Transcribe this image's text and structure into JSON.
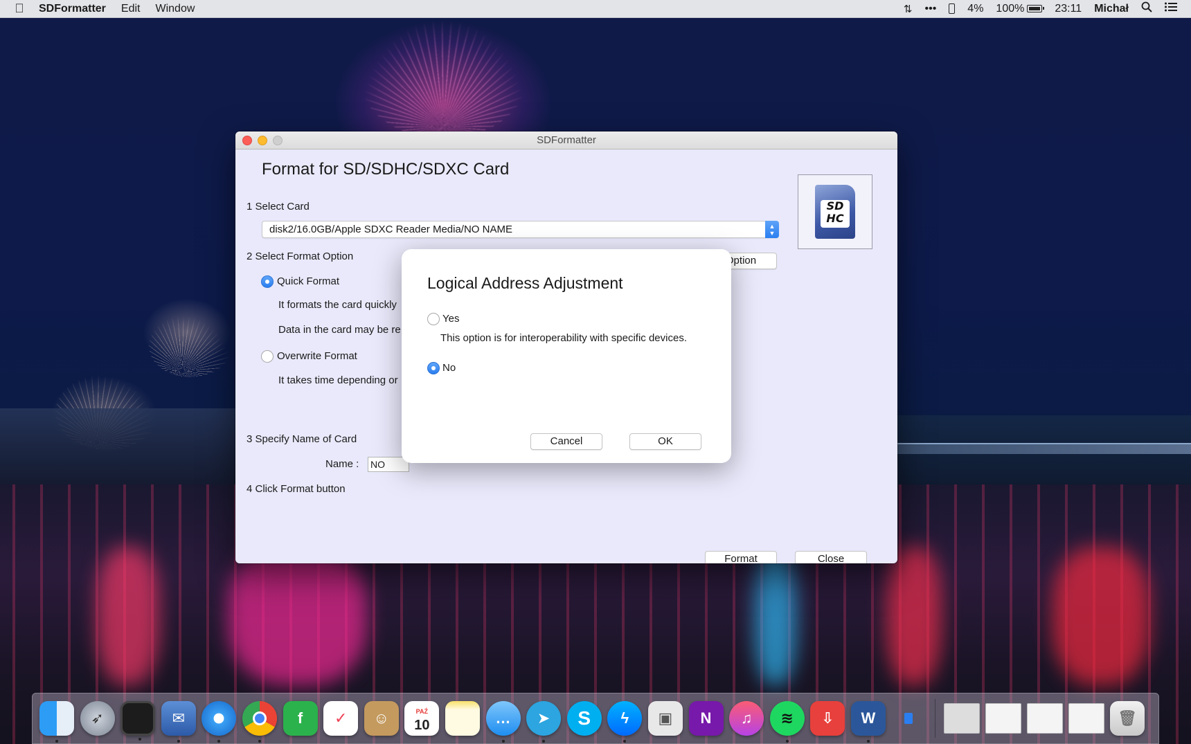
{
  "menubar": {
    "app_name": "SDFormatter",
    "menus": [
      "Edit",
      "Window"
    ],
    "status": {
      "extra1": "•••",
      "phone_battery": "4%",
      "battery": "100%",
      "time": "23:11",
      "user": "Michał"
    }
  },
  "window": {
    "title": "SDFormatter",
    "heading": "Format for SD/SDHC/SDXC Card",
    "step1": "1 Select Card",
    "card_selected": "disk2/16.0GB/Apple SDXC Reader Media/NO NAME",
    "step2": "2 Select Format Option",
    "option_button": "Option",
    "quick_format": "Quick Format",
    "quick_desc1": "It formats the card quickly",
    "quick_desc2": "Data in the card may be re",
    "overwrite_format": "Overwrite Format",
    "overwrite_desc": "It takes time depending or",
    "step3": "3 Specify Name of Card",
    "name_label": "Name :",
    "name_value": "NO NAME",
    "step4": "4 Click Format button",
    "format_button": "Format",
    "close_button": "Close",
    "sd_logo_top": "SD",
    "sd_logo_bottom": "HC"
  },
  "dialog": {
    "title": "Logical Address Adjustment",
    "yes_label": "Yes",
    "yes_desc": "This option is for interoperability with specific devices.",
    "no_label": "No",
    "selected": "No",
    "cancel_button": "Cancel",
    "ok_button": "OK"
  },
  "dock": {
    "calendar_month": "PAŹ",
    "calendar_day": "10",
    "apps": [
      "finder",
      "launchpad",
      "photo-browser",
      "mail",
      "safari",
      "chrome",
      "feedly",
      "pocket",
      "contacts",
      "calendar",
      "notes",
      "messages",
      "telegram",
      "skype",
      "messenger",
      "preview",
      "onenote",
      "itunes",
      "spotify",
      "downloader",
      "word",
      "app-store-mini"
    ]
  },
  "colors": {
    "accent": "#2b7ef0",
    "window_bg": "#e9e9fb"
  }
}
